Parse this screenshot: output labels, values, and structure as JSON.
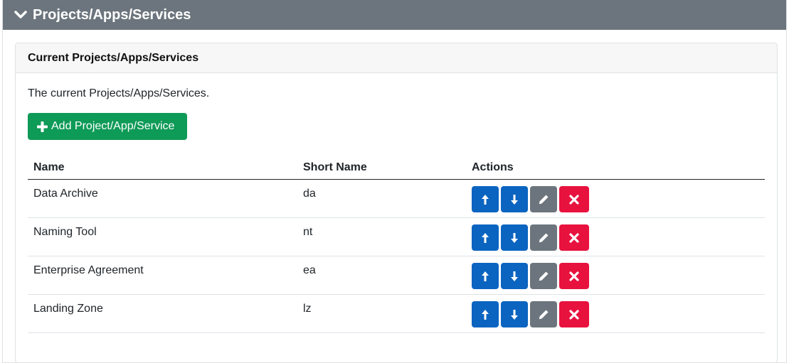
{
  "section": {
    "title": "Projects/Apps/Services"
  },
  "card": {
    "title": "Current Projects/Apps/Services",
    "description": "The current Projects/Apps/Services.",
    "add_button_label": "Add Project/App/Service"
  },
  "table": {
    "columns": [
      "Name",
      "Short Name",
      "Actions"
    ],
    "rows": [
      {
        "name": "Data Archive",
        "short_name": "da"
      },
      {
        "name": "Naming Tool",
        "short_name": "nt"
      },
      {
        "name": "Enterprise Agreement",
        "short_name": "ea"
      },
      {
        "name": "Landing Zone",
        "short_name": "lz"
      }
    ]
  },
  "icons": {
    "header": "chevron-down-icon",
    "add": "plus-icon",
    "move_up": "arrow-up-icon",
    "move_down": "arrow-down-icon",
    "edit": "pencil-icon",
    "delete": "close-icon"
  },
  "colors": {
    "header_bg": "#6c757d",
    "add_button": "#0e9a57",
    "move_buttons": "#0b64c0",
    "edit_button": "#6c757d",
    "delete_button": "#e8123e"
  }
}
